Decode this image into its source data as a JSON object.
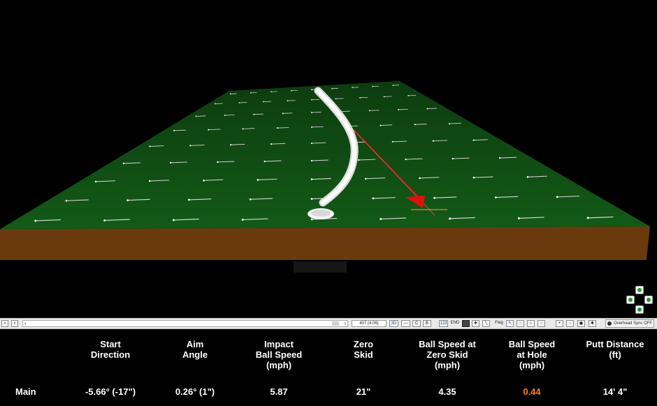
{
  "toolbar": {
    "left_arrow": "‹",
    "right_arrow": "›",
    "frame_value": "407  (4.06)",
    "btn_3d": "3D",
    "btn_dash": "---",
    "btn_c": "C",
    "btn_b": "B",
    "btn_123": "123",
    "btn_end": "END",
    "btn_flag": "Flag",
    "overhead_sync": "Overhead Sync OFF"
  },
  "stats": {
    "headers": [
      "Start\nDirection",
      "Aim\nAngle",
      "Impact\nBall Speed\n(mph)",
      "Zero\nSkid",
      "Ball Speed at\nZero Skid\n(mph)",
      "Ball Speed\nat Hole\n(mph)",
      "Putt Distance\n(ft)"
    ],
    "row_label": "Main",
    "values": [
      "-5.66° (-17\")",
      "0.26° (1\")",
      "5.87",
      "21\"",
      "4.35",
      "0.44",
      "14' 4\""
    ],
    "highlight_color": "#ff7a2a",
    "text_color": "#ffffff"
  },
  "colors": {
    "green": "#0f4a12",
    "soil": "#6b3a0c",
    "putt_path": "#f2f2f2",
    "aim_line": "#d01010"
  }
}
